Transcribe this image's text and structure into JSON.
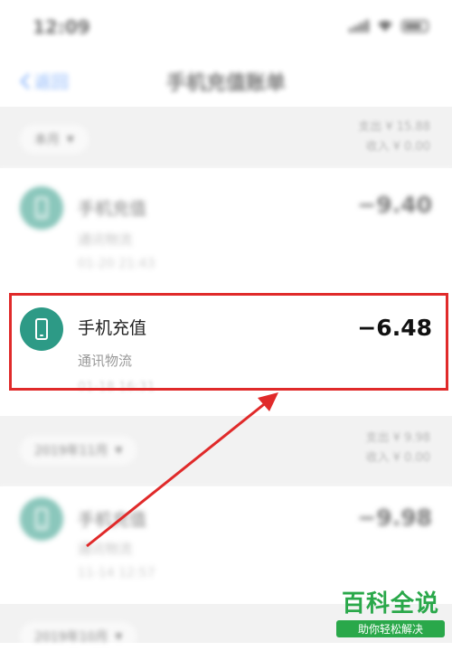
{
  "status": {
    "time": "12:09"
  },
  "nav": {
    "back_label": "返回",
    "title": "手机充值账单"
  },
  "section1": {
    "month": "本月",
    "summary_out": "支出 ¥ 15.88",
    "summary_in": "收入 ¥ 0.00"
  },
  "rows": [
    {
      "title": "手机充值",
      "sub": "通讯物流",
      "time": "01-20  21:43",
      "amount": "−9.40"
    },
    {
      "title": "手机充值",
      "sub": "通讯物流",
      "time": "01-18  16:31",
      "amount": "−6.48"
    },
    {
      "title": "手机充值",
      "sub": "通讯物流",
      "time": "11-14  12:57",
      "amount": "−9.98"
    }
  ],
  "section2": {
    "month": "2019年11月",
    "summary_out": "支出 ¥ 9.98",
    "summary_in": "收入 ¥ 0.00"
  },
  "section3": {
    "month": "2019年10月"
  },
  "watermark": {
    "main": "百科全说",
    "sub": "助你轻松解决"
  },
  "colors": {
    "accent": "#2f7cf6",
    "avatar": "#2d9a86",
    "highlight": "#e02a2a",
    "watermark": "#2aa84a"
  }
}
